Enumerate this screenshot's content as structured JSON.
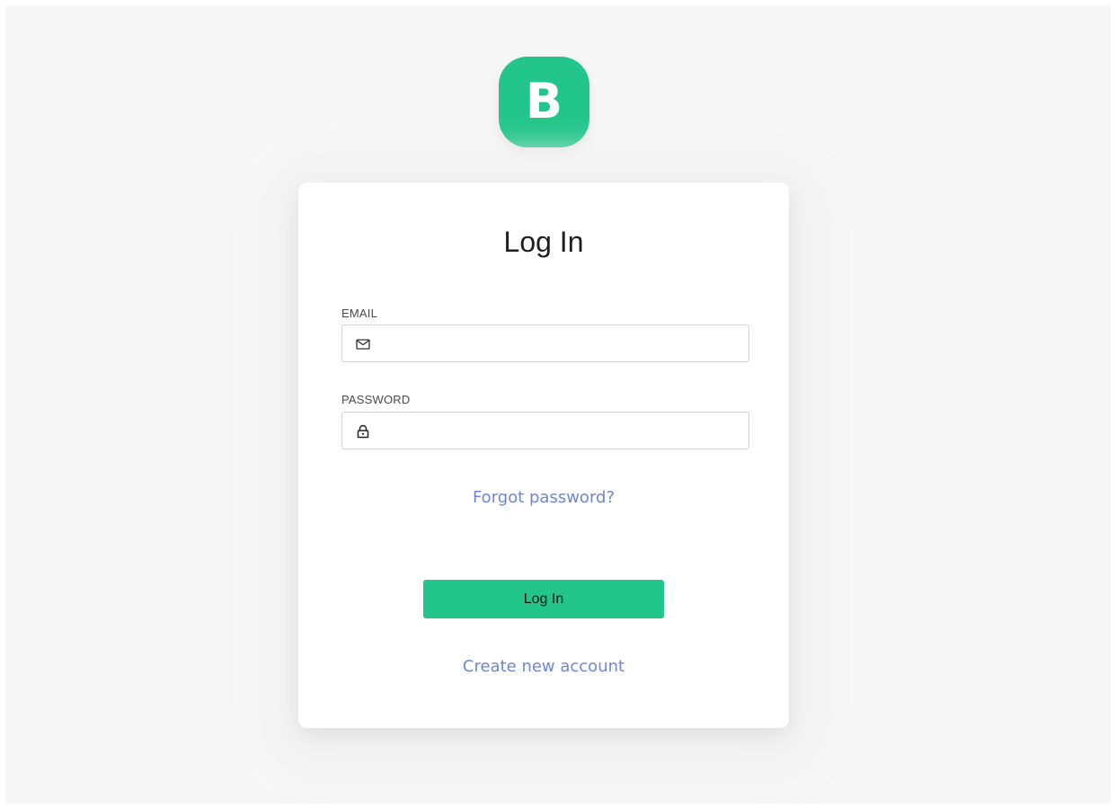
{
  "brand": {
    "logo_letter": "B",
    "accent_color": "#22c58b",
    "link_color": "#6f86d6"
  },
  "login": {
    "title": "Log In",
    "email": {
      "label": "EMAIL",
      "value": "",
      "placeholder": "",
      "icon": "mail-icon"
    },
    "password": {
      "label": "PASSWORD",
      "value": "",
      "placeholder": "",
      "icon": "lock-icon"
    },
    "forgot_link": "Forgot password?",
    "submit_label": "Log In",
    "create_account_link": "Create new account"
  }
}
